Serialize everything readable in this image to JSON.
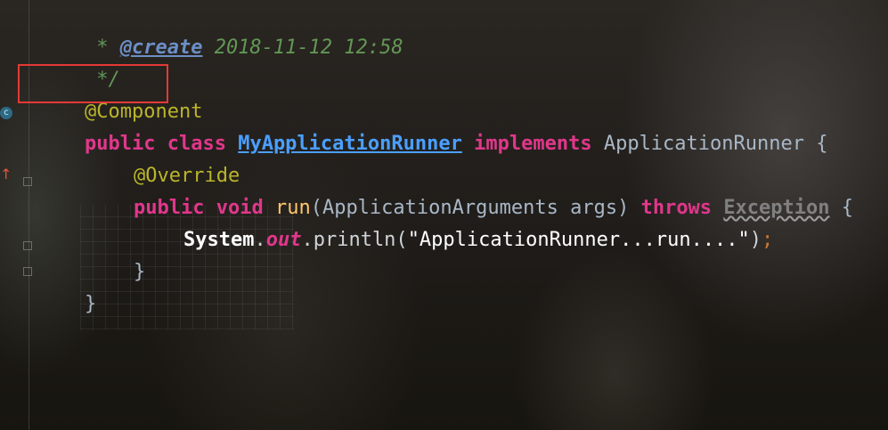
{
  "editor": {
    "comment_star": " * ",
    "comment_tag": "@create",
    "comment_date": " 2018-11-12 12:58",
    "comment_end": " */",
    "annotation_component": "@Component",
    "class_decl": {
      "kw_public": "public",
      "kw_class": "class",
      "class_name": "MyApplicationRunner",
      "kw_implements": "implements",
      "interface_name": "ApplicationRunner",
      "open_brace": " {"
    },
    "annotation_override": "@Override",
    "method_decl": {
      "kw_public": "public",
      "kw_void": "void",
      "method_name": "run",
      "params": "(ApplicationArguments args) ",
      "kw_throws": "throws",
      "exception": "Exception",
      "open_brace": " {"
    },
    "print_stmt": {
      "system": "System",
      "dot1": ".",
      "out": "out",
      "call": ".println(",
      "string": "\"ApplicationRunner...run....\"",
      "close": ")",
      "semicolon": ";"
    },
    "method_close": "}",
    "class_close": "}"
  },
  "gutter": {
    "class_icon": "spring-bean-icon",
    "override_icon": "override-arrow-icon"
  },
  "highlight": {
    "color": "#e53935"
  }
}
